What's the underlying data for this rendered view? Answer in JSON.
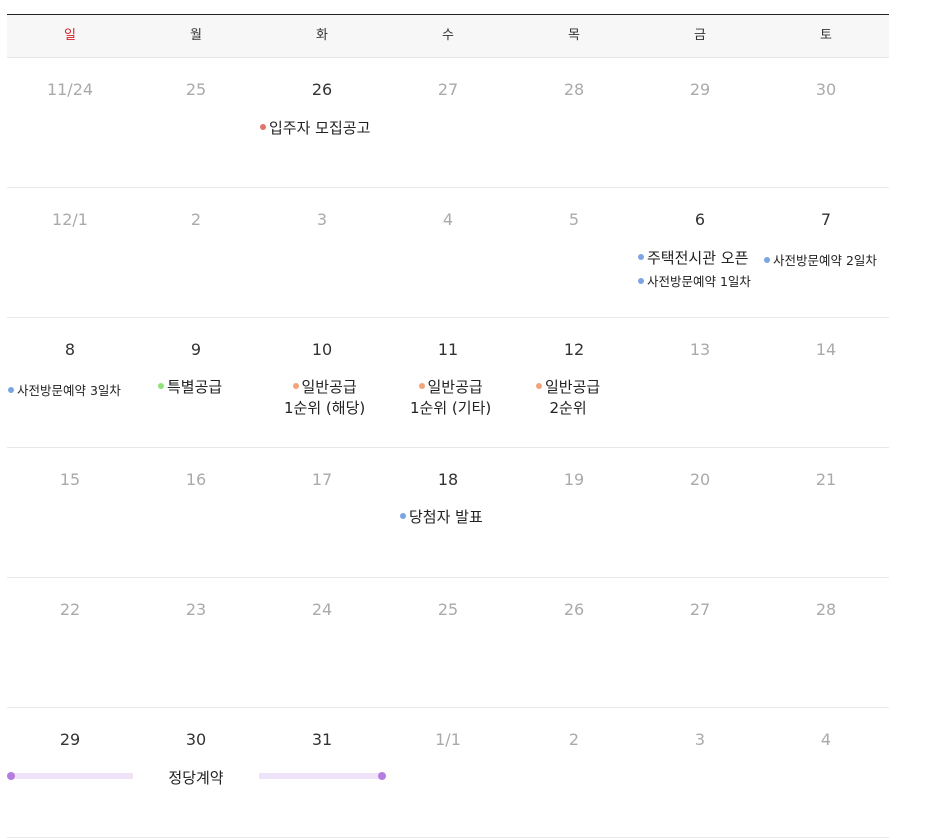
{
  "weekdays": [
    "일",
    "월",
    "화",
    "수",
    "목",
    "금",
    "토"
  ],
  "weeks": [
    [
      "11/24",
      "25",
      "26",
      "27",
      "28",
      "29",
      "30"
    ],
    [
      "12/1",
      "2",
      "3",
      "4",
      "5",
      "6",
      "7"
    ],
    [
      "8",
      "9",
      "10",
      "11",
      "12",
      "13",
      "14"
    ],
    [
      "15",
      "16",
      "17",
      "18",
      "19",
      "20",
      "21"
    ],
    [
      "22",
      "23",
      "24",
      "25",
      "26",
      "27",
      "28"
    ],
    [
      "29",
      "30",
      "31",
      "1/1",
      "2",
      "3",
      "4"
    ]
  ],
  "events": {
    "recruit_notice": "입주자 모집공고",
    "showroom_open": "주택전시관 오픈",
    "previsit_1": "사전방문예약 1일차",
    "previsit_2": "사전방문예약 2일차",
    "previsit_3": "사전방문예약 3일차",
    "special_supply": "특별공급",
    "general_1_local_a": "일반공급",
    "general_1_local_b": "1순위 (해당)",
    "general_1_other_a": "일반공급",
    "general_1_other_b": "1순위 (기타)",
    "general_2_a": "일반공급",
    "general_2_b": "2순위",
    "winner_announce": "당첨자 발표",
    "contract": "정당계약"
  },
  "colors": {
    "sunday": "#d5252e",
    "red": "#e0736b",
    "blue": "#7ba4e3",
    "green": "#8fe27a",
    "orange": "#f3a37a",
    "purple": "#b57de0",
    "purple_bar": "#efe3fa"
  }
}
